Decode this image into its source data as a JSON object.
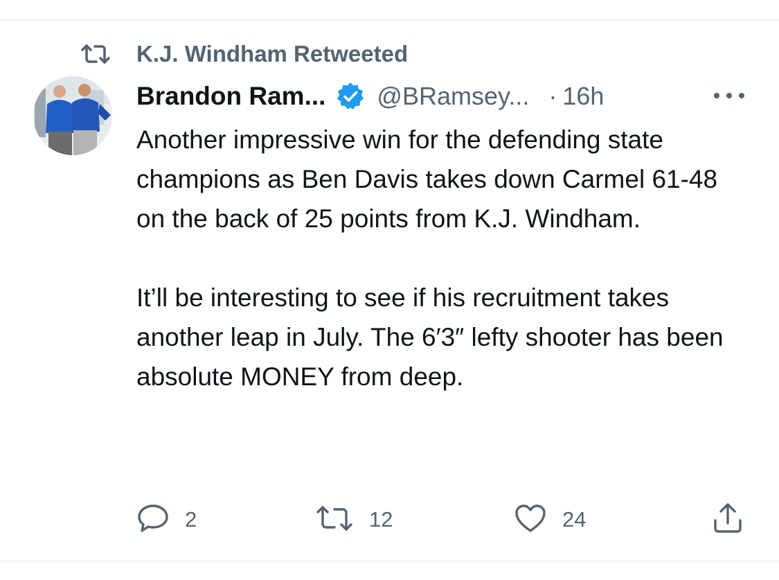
{
  "retweet_banner": {
    "label": "K.J. Windham Retweeted",
    "icon": "retweet-icon"
  },
  "author": {
    "display_name": "Brandon Ram...",
    "verified": true,
    "handle": "@BRamsey...",
    "separator": "·",
    "time": "16h"
  },
  "tweet": {
    "paragraphs": [
      "Another impressive win for the defending state champions as Ben Davis takes down Carmel 61-48 on the back of 25 points from K.J. Windham.",
      "It’ll be interesting to see if his recruitment takes another leap in July. The 6′3″ lefty shooter has been absolute MONEY from deep."
    ]
  },
  "actions": {
    "reply_count": "2",
    "retweet_count": "12",
    "like_count": "24"
  },
  "colors": {
    "text_primary": "#0f1419",
    "text_secondary": "#536471",
    "verified_blue": "#1d9bf0",
    "divider": "#eff3f4"
  },
  "icons": [
    "retweet-icon",
    "verified-badge-icon",
    "more-icon",
    "reply-icon",
    "retweet-icon",
    "like-icon",
    "share-icon"
  ]
}
